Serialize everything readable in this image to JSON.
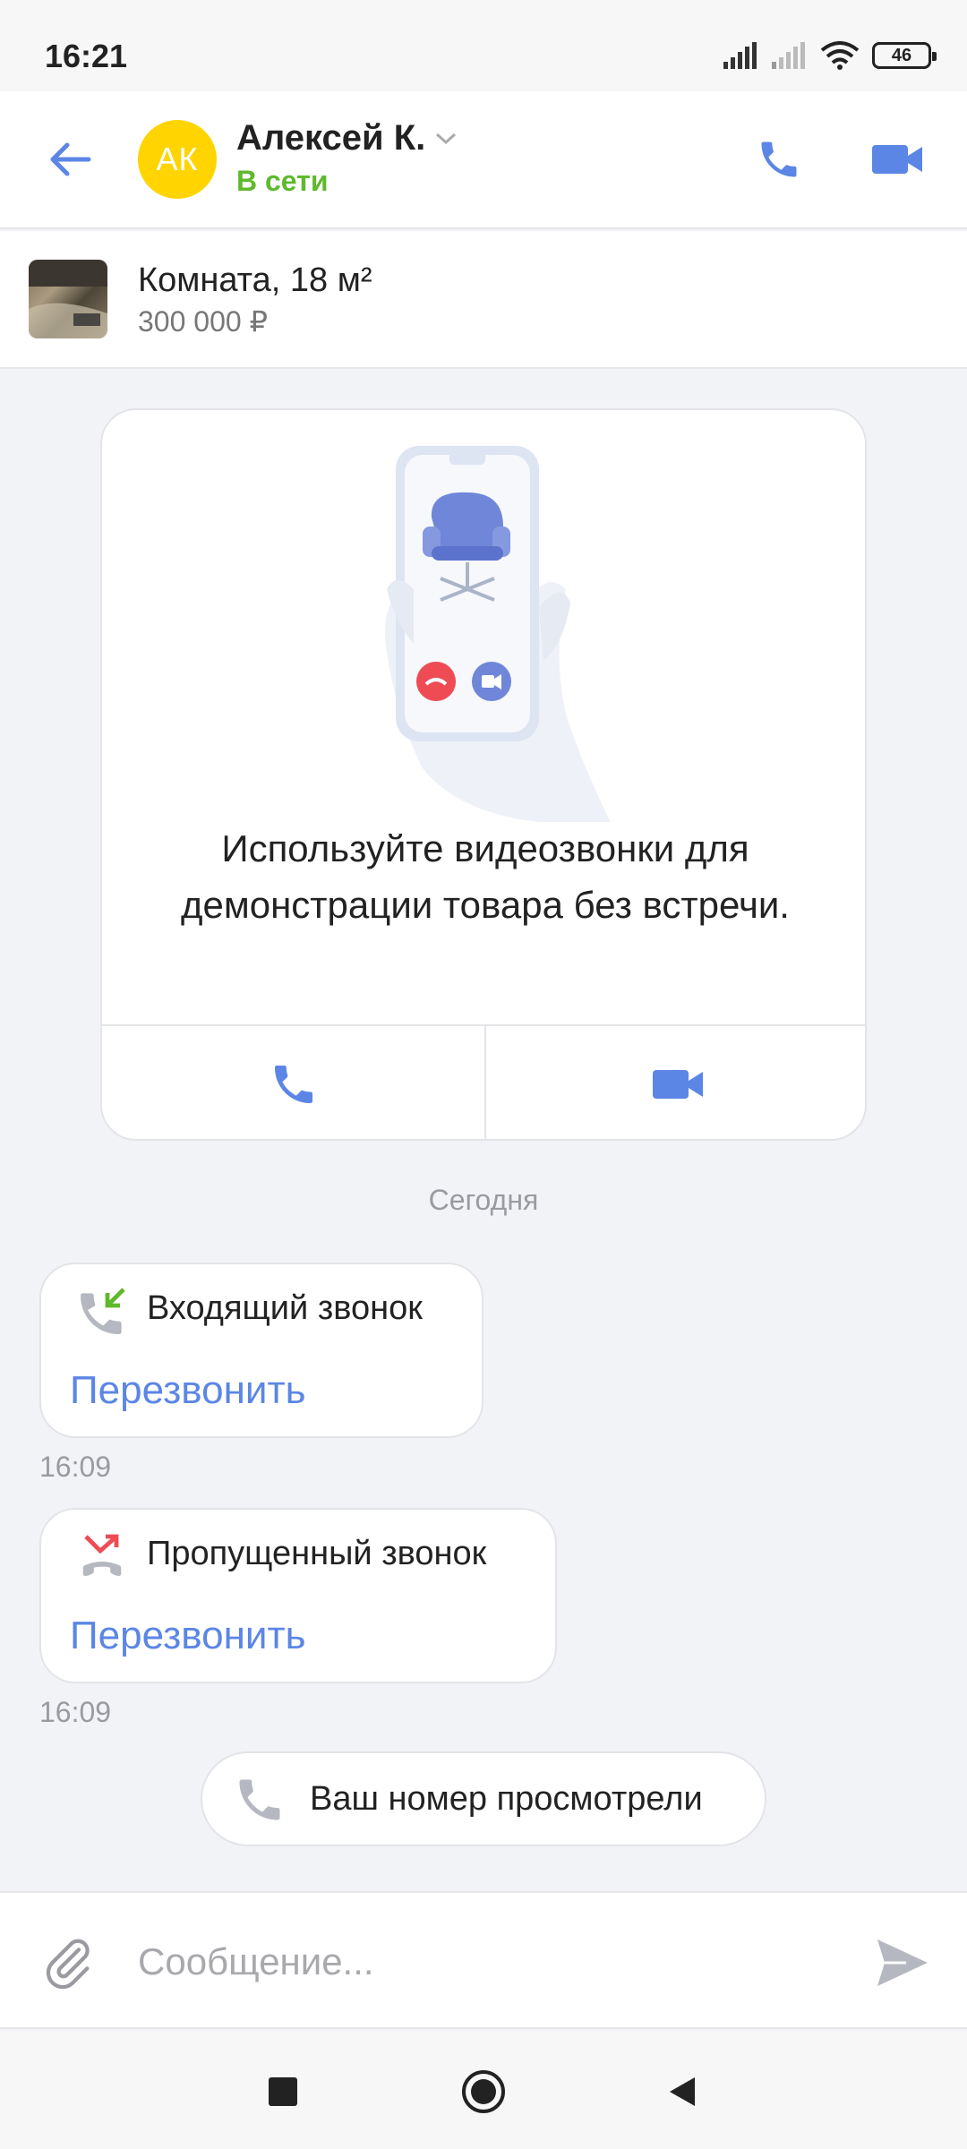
{
  "status_bar": {
    "time": "16:21",
    "battery": "46"
  },
  "header": {
    "avatar_initials": "АК",
    "contact_name": "Алексей К.",
    "contact_status": "В сети",
    "colors": {
      "accent": "#5b86e5",
      "online": "#5fb92c",
      "avatar": "#ffd400"
    }
  },
  "listing": {
    "title": "Комната, 18 м²",
    "price": "300 000 ₽"
  },
  "promo": {
    "text": "Используйте видеозвонки для демонстрации товара без встречи."
  },
  "date_separator": "Сегодня",
  "messages": [
    {
      "title": "Входящий звонок",
      "action": "Перезвонить",
      "time": "16:09",
      "icon": "incoming-call-icon"
    },
    {
      "title": "Пропущенный звонок",
      "action": "Перезвонить",
      "time": "16:09",
      "icon": "missed-call-icon"
    }
  ],
  "system_chip": {
    "text": "Ваш номер просмотрели",
    "icon": "phone-icon"
  },
  "composer": {
    "placeholder": "Сообщение..."
  }
}
